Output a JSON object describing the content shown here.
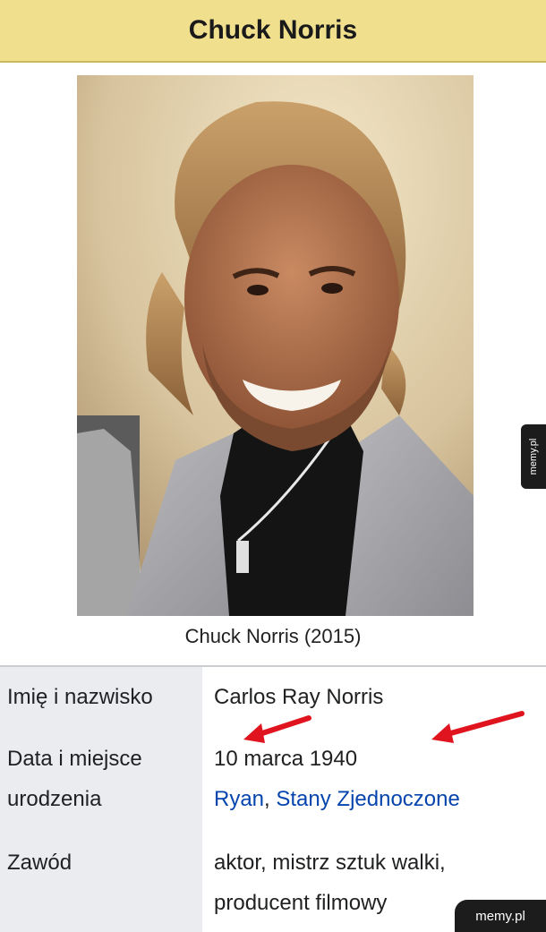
{
  "infobox": {
    "title": "Chuck Norris",
    "photo_caption": "Chuck Norris (2015)",
    "rows": [
      {
        "label": "Imię i nazwisko",
        "value": "Carlos Ray Norris"
      },
      {
        "label_line1": "Data i miejsce",
        "label_line2": "urodzenia",
        "value_line1": "10 marca 1940",
        "value_link1": "Ryan",
        "value_sep": ", ",
        "value_link2": "Stany Zjednoczone"
      },
      {
        "label": "Zawód",
        "value_line1": "aktor, mistrz sztuk walki,",
        "value_line2": "producent filmowy"
      }
    ]
  },
  "watermark": {
    "side": "memy.pl",
    "corner": "memy.pl"
  },
  "colors": {
    "title_bg": "#f0e08e",
    "label_bg": "#eaecf0",
    "link": "#0645ad",
    "arrow": "#e0141e"
  }
}
